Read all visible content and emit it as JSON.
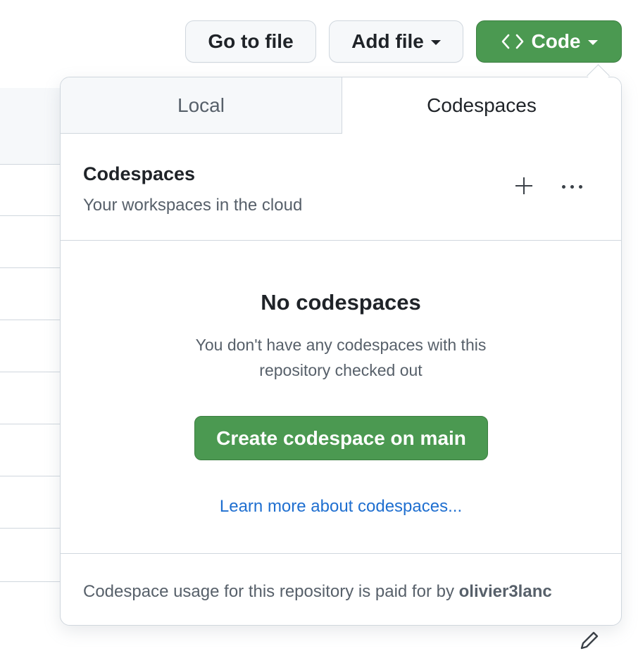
{
  "toolbar": {
    "go_to_file": "Go to file",
    "add_file": "Add file",
    "code": "Code"
  },
  "popover": {
    "tabs": [
      {
        "label": "Local",
        "selected": false
      },
      {
        "label": "Codespaces",
        "selected": true
      }
    ],
    "header": {
      "title": "Codespaces",
      "subtitle": "Your workspaces in the cloud"
    },
    "empty_state": {
      "title": "No codespaces",
      "description": "You don't have any codespaces with this repository checked out",
      "create_button": "Create codespace on main",
      "learn_more_link": "Learn more about codespaces..."
    },
    "footer": {
      "text": "Codespace usage for this repository is paid for by",
      "user": "olivier3lanc"
    }
  },
  "colors": {
    "primary_green": "#4b9951",
    "link_blue": "#1f6fd0",
    "border": "#d0d7de",
    "muted_text": "#57606a"
  },
  "icons": [
    "code-icon",
    "caret-down-icon",
    "plus-icon",
    "kebab-horizontal-icon",
    "pencil-icon"
  ]
}
